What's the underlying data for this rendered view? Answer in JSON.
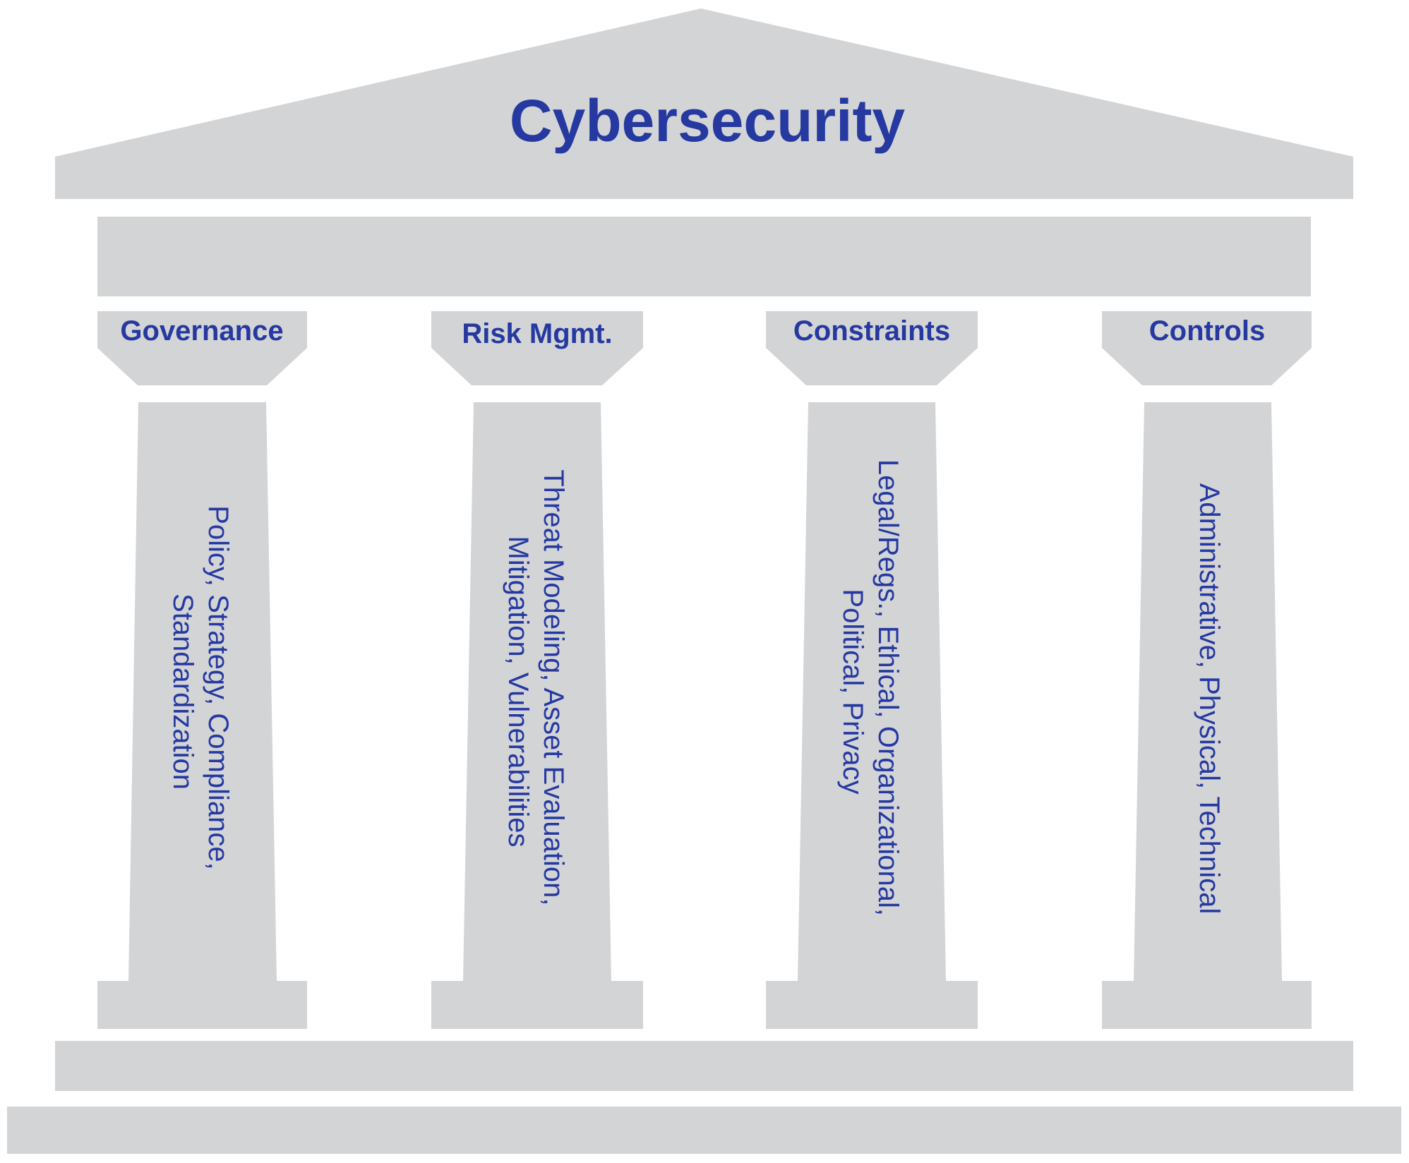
{
  "title": "Cybersecurity",
  "colors": {
    "stone": "#d3d4d6",
    "text": "#2539a0",
    "background": "#ffffff"
  },
  "pillars": [
    {
      "heading": "Governance",
      "lines": [
        "Policy, Strategy, Compliance,",
        "Standardization"
      ]
    },
    {
      "heading": "Risk Mgmt.",
      "lines": [
        "Threat Modeling, Asset Evaluation,",
        "Mitigation, Vulnerabilities"
      ]
    },
    {
      "heading": "Constraints",
      "lines": [
        "Legal/Regs., Ethical, Organizational,",
        "Political, Privacy"
      ]
    },
    {
      "heading": "Controls",
      "lines": [
        "Administrative, Physical, Technical"
      ]
    }
  ]
}
